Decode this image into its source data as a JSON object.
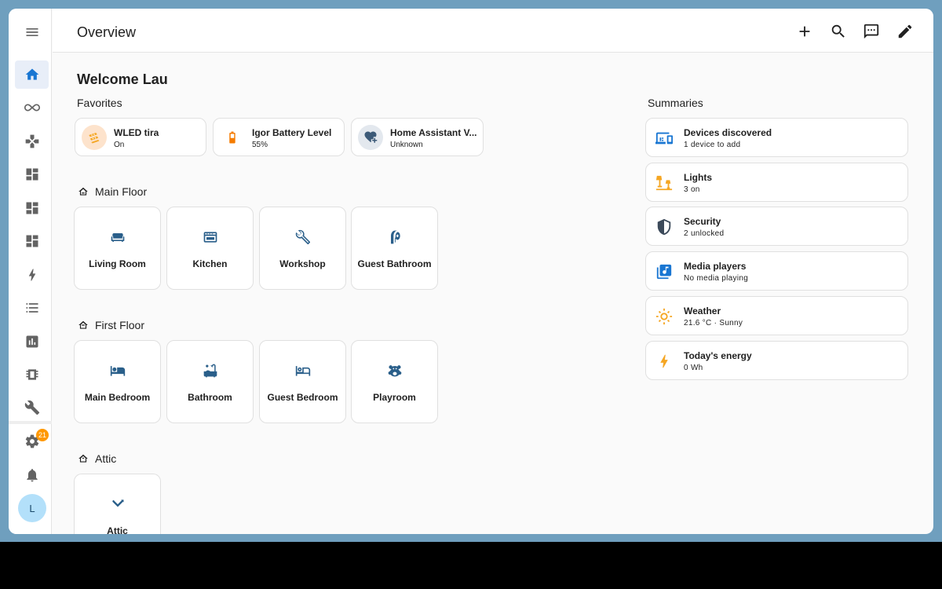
{
  "colors": {
    "primary": "#1976d2",
    "area_icon": "#2a5f8a",
    "badge": "#ff9800",
    "lights": "#f5a623",
    "weather": "#f5a623",
    "energy": "#f5a623"
  },
  "header": {
    "title": "Overview",
    "actions": [
      {
        "name": "add",
        "icon": "plus-icon"
      },
      {
        "name": "search",
        "icon": "search-icon"
      },
      {
        "name": "assist",
        "icon": "comment-icon"
      },
      {
        "name": "edit",
        "icon": "pencil-icon"
      }
    ]
  },
  "sidebar": {
    "menu_icon": "menu-icon",
    "items": [
      {
        "name": "overview",
        "icon": "home-icon"
      },
      {
        "name": "energy-infinity",
        "icon": "infinity-icon"
      },
      {
        "name": "map",
        "icon": "gamepad-icon"
      },
      {
        "name": "dashboard-1",
        "icon": "dashboard-icon"
      },
      {
        "name": "dashboard-2",
        "icon": "dashboard-icon"
      },
      {
        "name": "dashboard-3",
        "icon": "dashboard-icon"
      },
      {
        "name": "energy",
        "icon": "lightning-icon"
      },
      {
        "name": "todo",
        "icon": "list-icon"
      },
      {
        "name": "history",
        "icon": "chart-icon"
      },
      {
        "name": "hardware",
        "icon": "chip-icon"
      },
      {
        "name": "developer-tools",
        "icon": "wrench-icon"
      }
    ],
    "settings_badge": "21",
    "avatar_initial": "L"
  },
  "welcome": "Welcome Lau",
  "favorites": {
    "label": "Favorites",
    "items": [
      {
        "name": "WLED tira",
        "state": "On"
      },
      {
        "name": "Igor Battery Level",
        "state": "55%"
      },
      {
        "name": "Home Assistant V...",
        "state": "Unknown"
      }
    ]
  },
  "floors": [
    {
      "name": "Main Floor",
      "areas": [
        "Living Room",
        "Kitchen",
        "Workshop",
        "Guest Bathroom"
      ]
    },
    {
      "name": "First Floor",
      "areas": [
        "Main Bedroom",
        "Bathroom",
        "Guest Bedroom",
        "Playroom"
      ]
    },
    {
      "name": "Attic",
      "areas": [
        "Attic"
      ]
    }
  ],
  "summaries": {
    "label": "Summaries",
    "items": [
      {
        "name": "Devices discovered",
        "state": "1 device to add"
      },
      {
        "name": "Lights",
        "state": "3 on"
      },
      {
        "name": "Security",
        "state": "2 unlocked"
      },
      {
        "name": "Media players",
        "state": "No media playing"
      },
      {
        "name": "Weather",
        "state": "21.6 °C · Sunny"
      },
      {
        "name": "Today's energy",
        "state": "0 Wh"
      }
    ]
  }
}
